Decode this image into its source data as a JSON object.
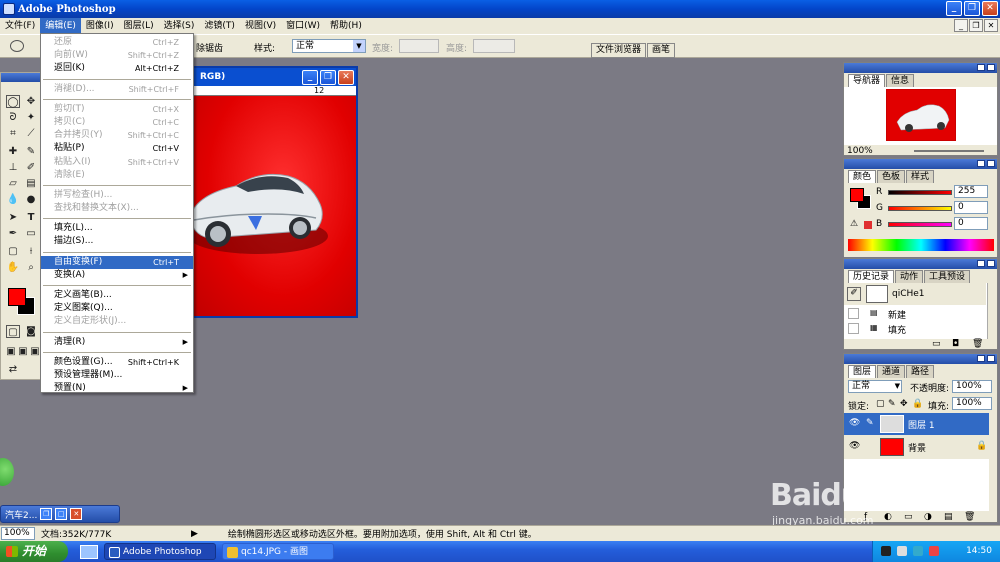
{
  "app": {
    "title": "Adobe Photoshop"
  },
  "menubar": {
    "items": [
      "文件(F)",
      "编辑(E)",
      "图像(I)",
      "图层(L)",
      "选择(S)",
      "滤镜(T)",
      "视图(V)",
      "窗口(W)",
      "帮助(H)"
    ]
  },
  "options": {
    "antialias_label": "除锯齿",
    "style_label": "样式:",
    "style_value": "正常",
    "width_label": "宽度:",
    "height_label": "高度:",
    "file_browser": "文件浏览器",
    "brushes": "画笔"
  },
  "document": {
    "title_suffix": "RGB)",
    "ruler_label": "12"
  },
  "edit_menu": {
    "items": [
      {
        "label": "还原",
        "shortcut": "Ctrl+Z",
        "disabled": true
      },
      {
        "label": "向前(W)",
        "shortcut": "Shift+Ctrl+Z",
        "disabled": true
      },
      {
        "label": "返回(K)",
        "shortcut": "Alt+Ctrl+Z",
        "disabled": false
      },
      {
        "sep": true
      },
      {
        "label": "消褪(D)...",
        "shortcut": "Shift+Ctrl+F",
        "disabled": true
      },
      {
        "sep": true
      },
      {
        "label": "剪切(T)",
        "shortcut": "Ctrl+X",
        "disabled": true
      },
      {
        "label": "拷贝(C)",
        "shortcut": "Ctrl+C",
        "disabled": true
      },
      {
        "label": "合并拷贝(Y)",
        "shortcut": "Shift+Ctrl+C",
        "disabled": true
      },
      {
        "label": "粘贴(P)",
        "shortcut": "Ctrl+V",
        "disabled": false
      },
      {
        "label": "粘贴入(I)",
        "shortcut": "Shift+Ctrl+V",
        "disabled": true
      },
      {
        "label": "清除(E)",
        "shortcut": "",
        "disabled": true
      },
      {
        "sep": true
      },
      {
        "label": "拼写检查(H)...",
        "shortcut": "",
        "disabled": true
      },
      {
        "label": "查找和替换文本(X)...",
        "shortcut": "",
        "disabled": true
      },
      {
        "sep": true
      },
      {
        "label": "填充(L)...",
        "shortcut": "",
        "disabled": false
      },
      {
        "label": "描边(S)...",
        "shortcut": "",
        "disabled": false
      },
      {
        "sep": true
      },
      {
        "label": "自由变换(F)",
        "shortcut": "Ctrl+T",
        "disabled": false,
        "highlight": true
      },
      {
        "label": "变换(A)",
        "shortcut": "",
        "disabled": false,
        "submenu": true
      },
      {
        "sep": true
      },
      {
        "label": "定义画笔(B)...",
        "shortcut": "",
        "disabled": false
      },
      {
        "label": "定义图案(Q)...",
        "shortcut": "",
        "disabled": false
      },
      {
        "label": "定义自定形状(J)...",
        "shortcut": "",
        "disabled": true
      },
      {
        "sep": true
      },
      {
        "label": "清理(R)",
        "shortcut": "",
        "disabled": false,
        "submenu": true
      },
      {
        "sep": true
      },
      {
        "label": "颜色设置(G)...",
        "shortcut": "Shift+Ctrl+K",
        "disabled": false
      },
      {
        "label": "预设管理器(M)...",
        "shortcut": "",
        "disabled": false
      },
      {
        "label": "预置(N)",
        "shortcut": "",
        "disabled": false,
        "submenu": true
      }
    ]
  },
  "navigator": {
    "tabs": [
      "导航器",
      "信息"
    ],
    "zoom": "100%"
  },
  "color": {
    "tabs": [
      "颜色",
      "色板",
      "样式"
    ],
    "r_label": "R",
    "g_label": "G",
    "b_label": "B",
    "r": "255",
    "g": "0",
    "b": "0"
  },
  "history": {
    "tabs": [
      "历史记录",
      "动作",
      "工具预设"
    ],
    "snapshot": "qiCHe1",
    "items": [
      "新建",
      "填充"
    ]
  },
  "layers": {
    "tabs": [
      "图层",
      "通道",
      "路径"
    ],
    "blend_mode": "正常",
    "opacity_label": "不透明度:",
    "opacity": "100%",
    "lock_label": "锁定:",
    "fill_label": "填充:",
    "fill": "100%",
    "rows": [
      {
        "name": "图层 1",
        "selected": true
      },
      {
        "name": "背景",
        "selected": false
      }
    ]
  },
  "minimized_window": {
    "title": "汽车2..."
  },
  "status": {
    "zoom": "100%",
    "doc_size": "文档:352K/777K",
    "message": "绘制椭圆形选区或移动选区外框。要用附加选项，使用 Shift, Alt 和 Ctrl 键。"
  },
  "taskbar": {
    "start": "开始",
    "buttons": [
      "Adobe Photoshop",
      "qc14.JPG - 画图"
    ],
    "clock": "14:50"
  },
  "watermark": {
    "brand": "Baidu经验",
    "url": "jingyan.baidu.com"
  },
  "colors": {
    "accent": "#316ac5",
    "fg": "#ff0000",
    "bg": "#000000",
    "taskbar": "#245edb"
  }
}
